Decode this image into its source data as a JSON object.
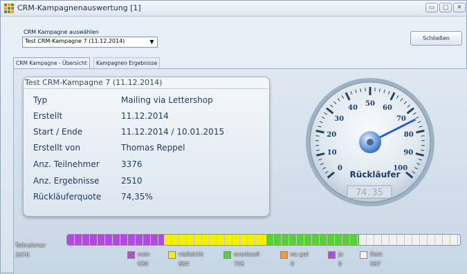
{
  "window": {
    "title": "CRM-Kampagnenauswertung  [1]",
    "controls": {
      "minimize": "▭",
      "maximize": "□",
      "close": "✕"
    }
  },
  "header": {
    "select_label": "CRM Kampagne auswählen",
    "select_value": "Test CRM-Kampagne 7 (11.12.2014)",
    "close_label": "Schließen"
  },
  "tabs": [
    {
      "label": "CRM Kampagne - Übersicht"
    },
    {
      "label": "Kampagnen Ergebnisse"
    }
  ],
  "info": {
    "title": "Test CRM-Kampagne 7 (11.12.2014)",
    "rows": [
      {
        "label": "Typ",
        "value": "Mailing via Lettershop"
      },
      {
        "label": "Erstellt",
        "value": "11.12.2014"
      },
      {
        "label": "Start / Ende",
        "value": "11.12.2014 / 10.01.2015"
      },
      {
        "label": "Erstellt von",
        "value": "Thomas Reppel"
      },
      {
        "label": "Anz. Teilnehmer",
        "value": "3376"
      },
      {
        "label": "Anz. Ergebnisse",
        "value": "2510"
      },
      {
        "label": "Rückläuferquote",
        "value": "74,35%"
      }
    ]
  },
  "gauge": {
    "label": "Rückläufer",
    "value": 74.35,
    "display": "74.35",
    "min": 0,
    "max": 100,
    "ticks": [
      "0",
      "10",
      "20",
      "30",
      "40",
      "50",
      "60",
      "70",
      "80",
      "90",
      "100"
    ]
  },
  "summary": {
    "participants_label": "Teilnehmer",
    "participants_value": "3376",
    "segments": [
      {
        "name": "nein",
        "value": "830",
        "count": 830,
        "color": "#b14ae0"
      },
      {
        "name": "vielleicht",
        "value": "884",
        "count": 884,
        "color": "#f3f000"
      },
      {
        "name": "eventuell",
        "value": "795",
        "count": 795,
        "color": "#58cf3b"
      },
      {
        "name": "na gut",
        "value": "0",
        "count": 0,
        "color": "#f59b26"
      },
      {
        "name": "ja",
        "value": "0",
        "count": 0,
        "color": "#b14ae0"
      },
      {
        "name": "Rest",
        "value": "867",
        "count": 867,
        "color": "#f1f1f1"
      }
    ]
  }
}
